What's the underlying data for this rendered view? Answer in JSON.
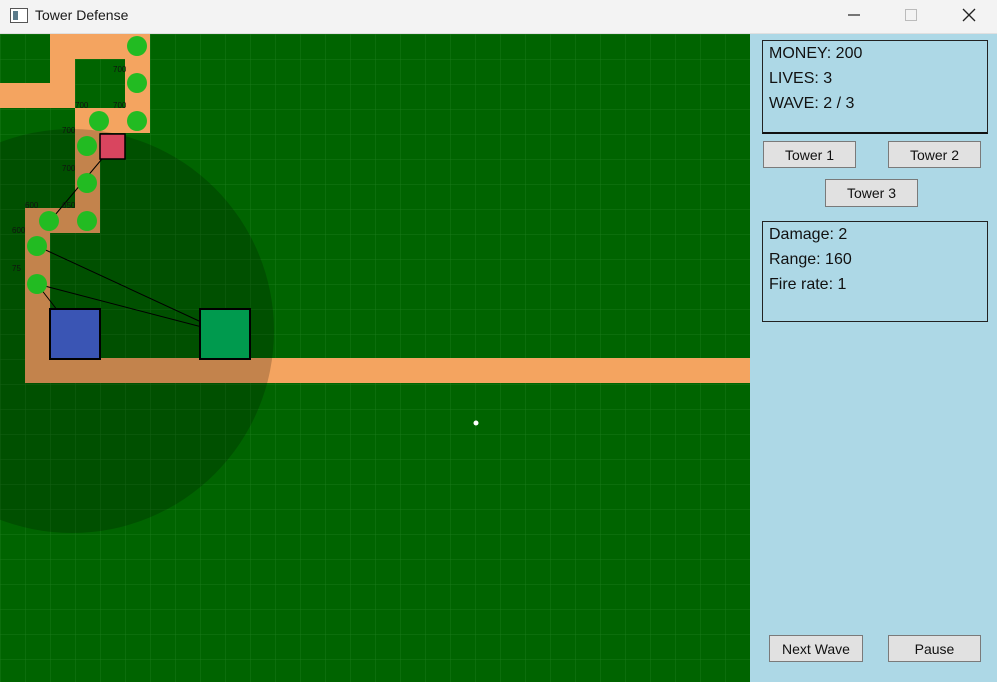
{
  "window": {
    "title": "Tower Defense",
    "controls": [
      "minimize",
      "maximize",
      "close"
    ]
  },
  "stats": {
    "money": "MONEY: 200",
    "lives": "LIVES: 3",
    "wave": "WAVE: 2 / 3"
  },
  "buttons": {
    "tower1": "Tower 1",
    "tower2": "Tower 2",
    "tower3": "Tower 3",
    "next_wave": "Next Wave",
    "pause": "Pause"
  },
  "tower_info": {
    "damage": "Damage: 2",
    "range": "Range: 160",
    "fire_rate": "Fire rate: 1"
  },
  "enemy_hp_labels": [
    "700",
    "700",
    "700",
    "700",
    "700",
    "600",
    "650",
    "600",
    "75"
  ],
  "colors": {
    "grass": "#006400",
    "grid": "#2e8b2e",
    "path": "#f4a460",
    "enemy": "#22bb22",
    "tower_blue": "#3a55b4",
    "tower_green": "#009a4e",
    "tower_red": "#d9455f",
    "panel": "#add8e6"
  }
}
